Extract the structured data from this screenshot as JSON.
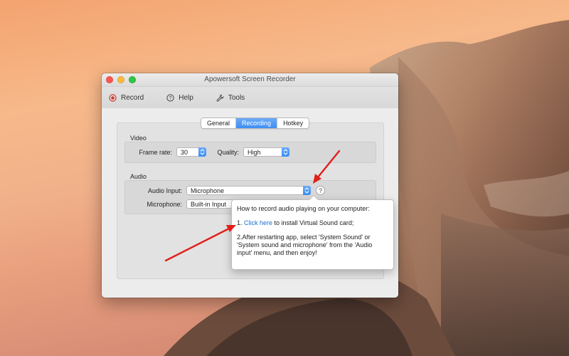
{
  "window": {
    "title": "Apowersoft Screen Recorder"
  },
  "toolbar": {
    "record_label": "Record",
    "help_label": "Help",
    "tools_label": "Tools"
  },
  "tabs": [
    {
      "label": "General",
      "active": false
    },
    {
      "label": "Recording",
      "active": true
    },
    {
      "label": "Hotkey",
      "active": false
    }
  ],
  "video": {
    "section_label": "Video",
    "frame_rate_label": "Frame rate:",
    "frame_rate_value": "30",
    "quality_label": "Quality:",
    "quality_value": "High"
  },
  "audio": {
    "section_label": "Audio",
    "audio_input_label": "Audio Input:",
    "audio_input_value": "Microphone",
    "microphone_label": "Microphone:",
    "microphone_value": "Built-in Input",
    "help_glyph": "?"
  },
  "popover": {
    "heading": "How to record audio playing on your computer:",
    "step1_prefix": "1. ",
    "step1_link": "Click here",
    "step1_suffix": " to install Virtual Sound card;",
    "step2_text": "2.After restarting app, select 'System Sound' or 'System sound and microphone' from the 'Audio input' menu, and then enjoy!"
  },
  "colors": {
    "accent": "#3d8ff4",
    "record_red": "#d23a2d",
    "annotation_arrow": "#e0201b",
    "link": "#1a6fd6"
  }
}
